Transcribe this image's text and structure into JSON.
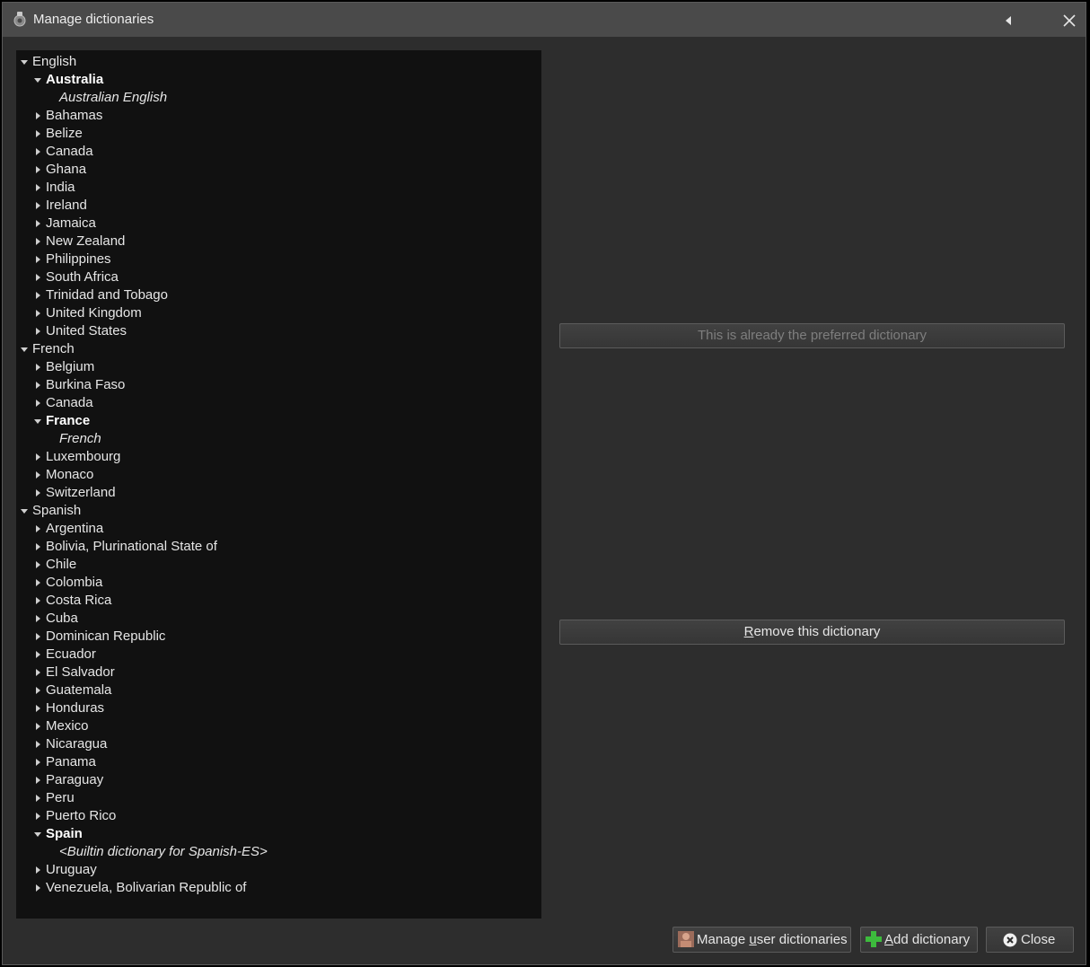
{
  "window": {
    "title": "Manage dictionaries"
  },
  "tree": [
    {
      "label": "English",
      "level": 0,
      "state": "expanded",
      "style": "normal"
    },
    {
      "label": "Australia",
      "level": 1,
      "state": "expanded",
      "style": "bold"
    },
    {
      "label": "Australian English",
      "level": 2,
      "state": "leaf",
      "style": "italic"
    },
    {
      "label": "Bahamas",
      "level": 1,
      "state": "collapsed",
      "style": "normal"
    },
    {
      "label": "Belize",
      "level": 1,
      "state": "collapsed",
      "style": "normal"
    },
    {
      "label": "Canada",
      "level": 1,
      "state": "collapsed",
      "style": "normal"
    },
    {
      "label": "Ghana",
      "level": 1,
      "state": "collapsed",
      "style": "normal"
    },
    {
      "label": "India",
      "level": 1,
      "state": "collapsed",
      "style": "normal"
    },
    {
      "label": "Ireland",
      "level": 1,
      "state": "collapsed",
      "style": "normal"
    },
    {
      "label": "Jamaica",
      "level": 1,
      "state": "collapsed",
      "style": "normal"
    },
    {
      "label": "New Zealand",
      "level": 1,
      "state": "collapsed",
      "style": "normal"
    },
    {
      "label": "Philippines",
      "level": 1,
      "state": "collapsed",
      "style": "normal"
    },
    {
      "label": "South Africa",
      "level": 1,
      "state": "collapsed",
      "style": "normal"
    },
    {
      "label": "Trinidad and Tobago",
      "level": 1,
      "state": "collapsed",
      "style": "normal"
    },
    {
      "label": "United Kingdom",
      "level": 1,
      "state": "collapsed",
      "style": "normal"
    },
    {
      "label": "United States",
      "level": 1,
      "state": "collapsed",
      "style": "normal"
    },
    {
      "label": "French",
      "level": 0,
      "state": "expanded",
      "style": "normal"
    },
    {
      "label": "Belgium",
      "level": 1,
      "state": "collapsed",
      "style": "normal"
    },
    {
      "label": "Burkina Faso",
      "level": 1,
      "state": "collapsed",
      "style": "normal"
    },
    {
      "label": "Canada",
      "level": 1,
      "state": "collapsed",
      "style": "normal"
    },
    {
      "label": "France",
      "level": 1,
      "state": "expanded",
      "style": "bold"
    },
    {
      "label": "French",
      "level": 2,
      "state": "leaf",
      "style": "italic"
    },
    {
      "label": "Luxembourg",
      "level": 1,
      "state": "collapsed",
      "style": "normal"
    },
    {
      "label": "Monaco",
      "level": 1,
      "state": "collapsed",
      "style": "normal"
    },
    {
      "label": "Switzerland",
      "level": 1,
      "state": "collapsed",
      "style": "normal"
    },
    {
      "label": "Spanish",
      "level": 0,
      "state": "expanded",
      "style": "normal"
    },
    {
      "label": "Argentina",
      "level": 1,
      "state": "collapsed",
      "style": "normal"
    },
    {
      "label": "Bolivia, Plurinational State of",
      "level": 1,
      "state": "collapsed",
      "style": "normal"
    },
    {
      "label": "Chile",
      "level": 1,
      "state": "collapsed",
      "style": "normal"
    },
    {
      "label": "Colombia",
      "level": 1,
      "state": "collapsed",
      "style": "normal"
    },
    {
      "label": "Costa Rica",
      "level": 1,
      "state": "collapsed",
      "style": "normal"
    },
    {
      "label": "Cuba",
      "level": 1,
      "state": "collapsed",
      "style": "normal"
    },
    {
      "label": "Dominican Republic",
      "level": 1,
      "state": "collapsed",
      "style": "normal"
    },
    {
      "label": "Ecuador",
      "level": 1,
      "state": "collapsed",
      "style": "normal"
    },
    {
      "label": "El Salvador",
      "level": 1,
      "state": "collapsed",
      "style": "normal"
    },
    {
      "label": "Guatemala",
      "level": 1,
      "state": "collapsed",
      "style": "normal"
    },
    {
      "label": "Honduras",
      "level": 1,
      "state": "collapsed",
      "style": "normal"
    },
    {
      "label": "Mexico",
      "level": 1,
      "state": "collapsed",
      "style": "normal"
    },
    {
      "label": "Nicaragua",
      "level": 1,
      "state": "collapsed",
      "style": "normal"
    },
    {
      "label": "Panama",
      "level": 1,
      "state": "collapsed",
      "style": "normal"
    },
    {
      "label": "Paraguay",
      "level": 1,
      "state": "collapsed",
      "style": "normal"
    },
    {
      "label": "Peru",
      "level": 1,
      "state": "collapsed",
      "style": "normal"
    },
    {
      "label": "Puerto Rico",
      "level": 1,
      "state": "collapsed",
      "style": "normal"
    },
    {
      "label": "Spain",
      "level": 1,
      "state": "expanded",
      "style": "bold"
    },
    {
      "label": "<Builtin dictionary for Spanish-ES>",
      "level": 2,
      "state": "leaf",
      "style": "italic"
    },
    {
      "label": "Uruguay",
      "level": 1,
      "state": "collapsed",
      "style": "normal"
    },
    {
      "label": "Venezuela, Bolivarian Republic of",
      "level": 1,
      "state": "collapsed",
      "style": "normal"
    }
  ],
  "detail": {
    "preferred_label": "This is already the preferred dictionary",
    "preferred_enabled": false,
    "remove_label_mnemonic": "R",
    "remove_label_rest": "emove this dictionary"
  },
  "footer": {
    "manage_label_pre": "Manage ",
    "manage_label_mnemonic": "u",
    "manage_label_post": "ser dictionaries",
    "manage_icon": "user-dictionaries-icon",
    "add_label_mnemonic": "A",
    "add_label_rest": "dd dictionary",
    "add_icon": "green-plus-icon",
    "close_label": "Close",
    "close_icon": "close-circle-icon"
  },
  "colors": {
    "window_bg": "#2d2d2d",
    "titlebar_bg": "#4a4a4a",
    "tree_bg": "#111111",
    "text": "#e6e6e6",
    "disabled_text": "#7e7e7e",
    "plus_green": "#3dbb3d"
  }
}
